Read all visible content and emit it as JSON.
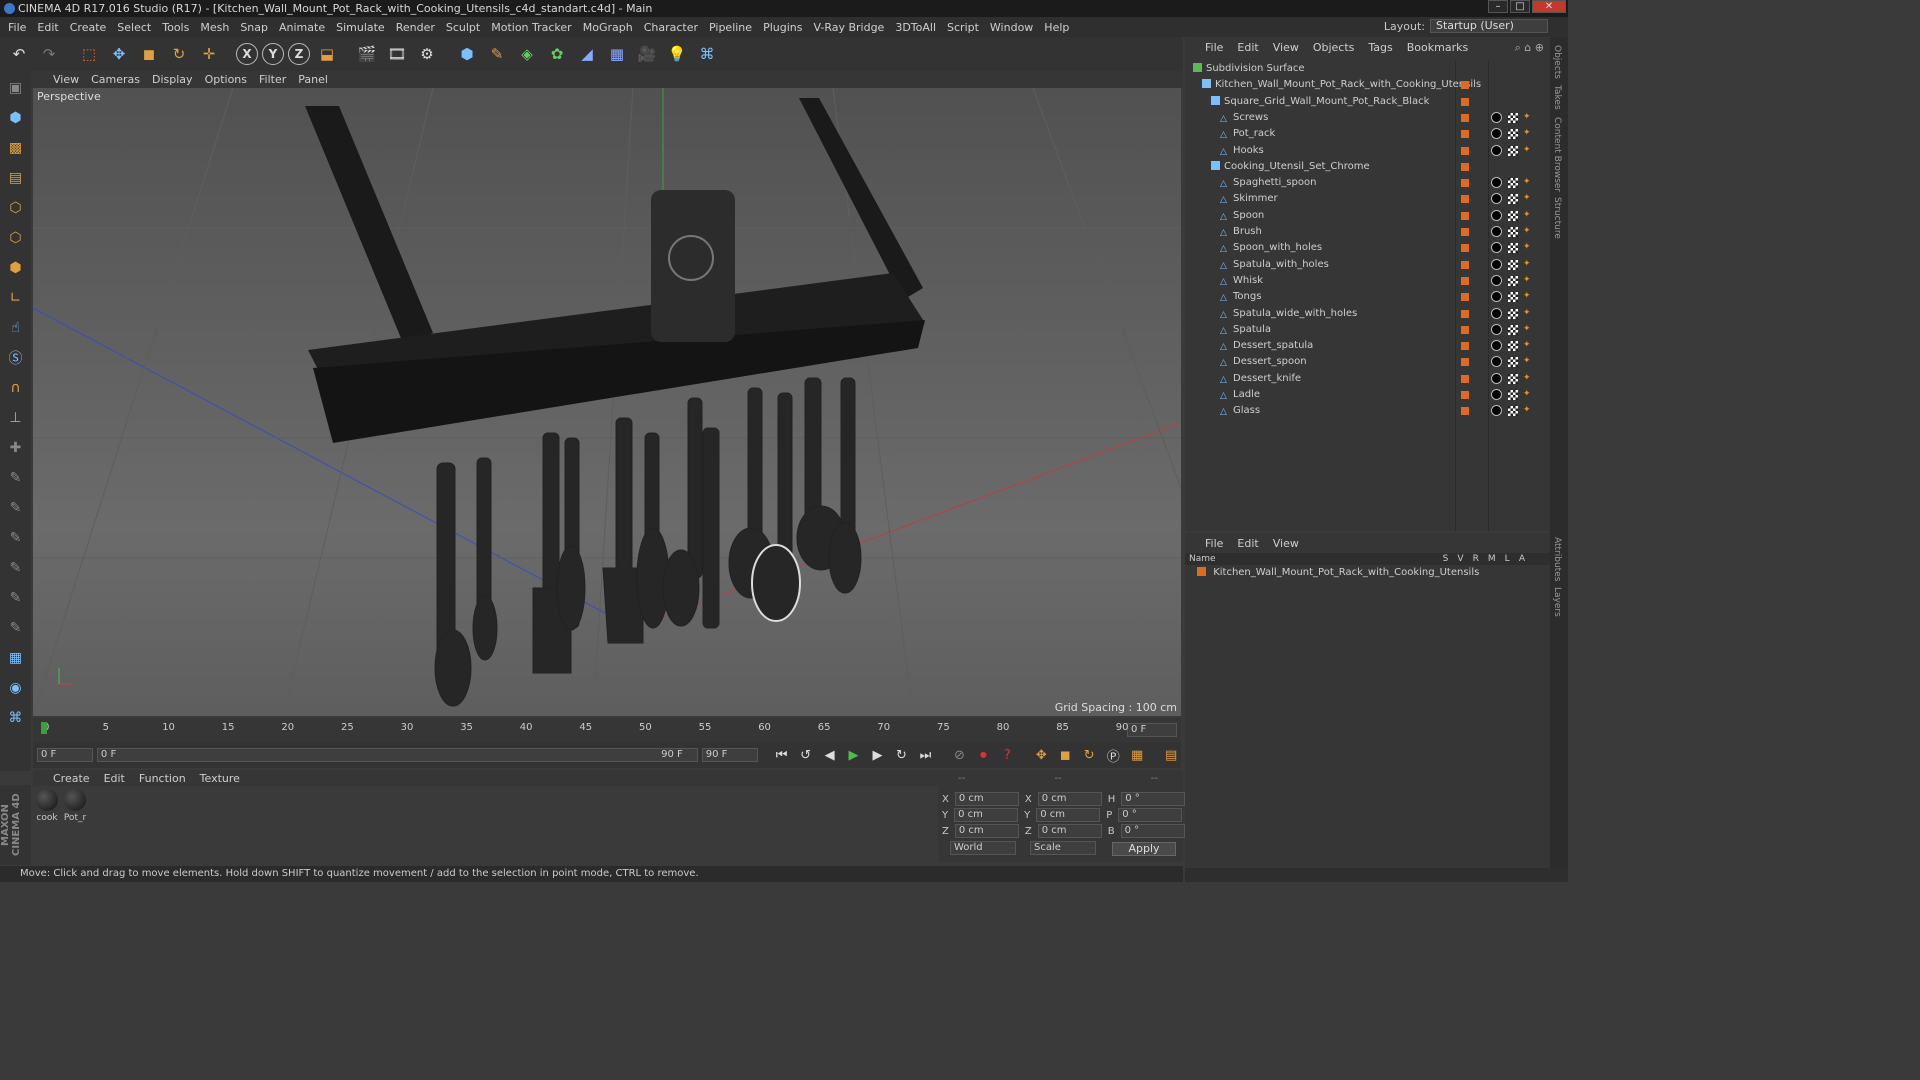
{
  "window": {
    "title": "CINEMA 4D R17.016 Studio (R17) - [Kitchen_Wall_Mount_Pot_Rack_with_Cooking_Utensils_c4d_standart.c4d] - Main"
  },
  "menu": [
    "File",
    "Edit",
    "Create",
    "Select",
    "Tools",
    "Mesh",
    "Snap",
    "Animate",
    "Simulate",
    "Render",
    "Sculpt",
    "Motion Tracker",
    "MoGraph",
    "Character",
    "Pipeline",
    "Plugins",
    "V-Ray Bridge",
    "3DToAll",
    "Script",
    "Window",
    "Help"
  ],
  "layout": {
    "label": "Layout:",
    "value": "Startup (User)"
  },
  "viewport": {
    "menu": [
      "View",
      "Cameras",
      "Display",
      "Options",
      "Filter",
      "Panel"
    ],
    "label": "Perspective",
    "grid_spacing": "Grid Spacing : 100 cm"
  },
  "timeline": {
    "ticks": [
      "0",
      "5",
      "10",
      "15",
      "20",
      "25",
      "30",
      "35",
      "40",
      "45",
      "50",
      "55",
      "60",
      "65",
      "70",
      "75",
      "80",
      "85",
      "90"
    ],
    "end_field": "0 F"
  },
  "transport": {
    "start": "0 F",
    "range_start": "0 F",
    "range_end": "90 F",
    "end": "90 F"
  },
  "materials": {
    "menu": [
      "Create",
      "Edit",
      "Function",
      "Texture"
    ],
    "items": [
      "cook",
      "Pot_r"
    ]
  },
  "coords": {
    "headers": [
      "--",
      "--",
      "--"
    ],
    "rows": [
      [
        "X",
        "0 cm",
        "X",
        "0 cm",
        "H",
        "0 °"
      ],
      [
        "Y",
        "0 cm",
        "Y",
        "0 cm",
        "P",
        "0 °"
      ],
      [
        "Z",
        "0 cm",
        "Z",
        "0 cm",
        "B",
        "0 °"
      ]
    ],
    "world": "World",
    "scale": "Scale",
    "apply": "Apply"
  },
  "status": "Move: Click and drag to move elements. Hold down SHIFT to quantize movement / add to the selection in point mode, CTRL to remove.",
  "maxon": "MAXON CINEMA 4D",
  "objects": {
    "menu": [
      "File",
      "Edit",
      "View",
      "Objects",
      "Tags",
      "Bookmarks"
    ],
    "rows": [
      {
        "name": "Subdivision Surface",
        "indent": 0
      },
      {
        "name": "Kitchen_Wall_Mount_Pot_Rack_with_Cooking_Utensils",
        "indent": 1
      },
      {
        "name": "Square_Grid_Wall_Mount_Pot_Rack_Black",
        "indent": 2
      },
      {
        "name": "Screws",
        "indent": 3
      },
      {
        "name": "Pot_rack",
        "indent": 3
      },
      {
        "name": "Hooks",
        "indent": 3
      },
      {
        "name": "Cooking_Utensil_Set_Chrome",
        "indent": 2
      },
      {
        "name": "Spaghetti_spoon",
        "indent": 3
      },
      {
        "name": "Skimmer",
        "indent": 3
      },
      {
        "name": "Spoon",
        "indent": 3
      },
      {
        "name": "Brush",
        "indent": 3
      },
      {
        "name": "Spoon_with_holes",
        "indent": 3
      },
      {
        "name": "Spatula_with_holes",
        "indent": 3
      },
      {
        "name": "Whisk",
        "indent": 3
      },
      {
        "name": "Tongs",
        "indent": 3
      },
      {
        "name": "Spatula_wide_with_holes",
        "indent": 3
      },
      {
        "name": "Spatula",
        "indent": 3
      },
      {
        "name": "Dessert_spatula",
        "indent": 3
      },
      {
        "name": "Dessert_spoon",
        "indent": 3
      },
      {
        "name": "Dessert_knife",
        "indent": 3
      },
      {
        "name": "Ladle",
        "indent": 3
      },
      {
        "name": "Glass",
        "indent": 3
      }
    ]
  },
  "layers": {
    "menu": [
      "File",
      "Edit",
      "View"
    ],
    "header": "Name",
    "cols": [
      "S",
      "V",
      "R",
      "M",
      "L",
      "A"
    ],
    "row": "Kitchen_Wall_Mount_Pot_Rack_with_Cooking_Utensils"
  },
  "sidetabs": [
    "Objects",
    "Takes",
    "Content Browser",
    "Structure",
    "Attributes",
    "Layers"
  ]
}
